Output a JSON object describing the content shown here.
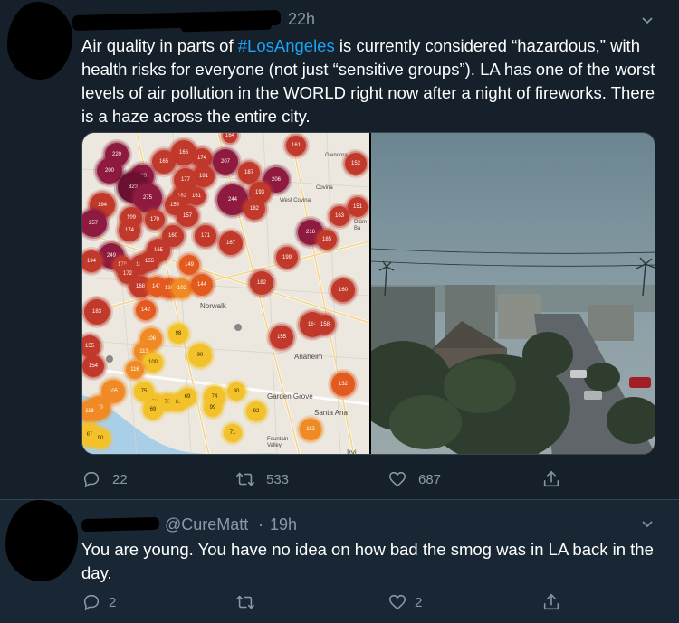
{
  "tweet1": {
    "timestamp": "22h",
    "text_before": "Air quality in parts of ",
    "hashtag": "#LosAngeles",
    "text_after": " is currently considered “hazardous,” with health risks for everyone (not just “sensitive groups”). LA has one of the worst levels of air pollution in the WORLD right now after a night of fireworks. There is a haze across the entire city.",
    "map_labels": {
      "glendora": "Glendora",
      "covina": "Covina",
      "west_covina": "West Covina",
      "norwalk": "Norwalk",
      "anaheim": "Anaheim",
      "garden_grove": "Garden Grove",
      "santa_ana": "Santa Ana",
      "fountain_valley": "Fountain Valley",
      "diamond_bar": "Diam Ba",
      "irvine": "Irvi"
    },
    "aqi_markers": [
      {
        "v": "164",
        "c": "#c0392b"
      },
      {
        "v": "161",
        "c": "#c0392b"
      },
      {
        "v": "220",
        "c": "#8e1b3f"
      },
      {
        "v": "166",
        "c": "#c0392b"
      },
      {
        "v": "174",
        "c": "#c0392b"
      },
      {
        "v": "207",
        "c": "#8e1b3f"
      },
      {
        "v": "187",
        "c": "#c0392b"
      },
      {
        "v": "152",
        "c": "#c0392b"
      },
      {
        "v": "165",
        "c": "#c0392b"
      },
      {
        "v": "200",
        "c": "#8e1b3f"
      },
      {
        "v": "181",
        "c": "#c0392b"
      },
      {
        "v": "233",
        "c": "#8e1b3f"
      },
      {
        "v": "177",
        "c": "#c0392b"
      },
      {
        "v": "206",
        "c": "#8e1b3f"
      },
      {
        "v": "323",
        "c": "#6b1030"
      },
      {
        "v": "275",
        "c": "#8e1b3f"
      },
      {
        "v": "162",
        "c": "#c0392b"
      },
      {
        "v": "161",
        "c": "#c0392b"
      },
      {
        "v": "193",
        "c": "#c0392b"
      },
      {
        "v": "244",
        "c": "#8e1b3f"
      },
      {
        "v": "194",
        "c": "#c0392b"
      },
      {
        "v": "156",
        "c": "#c0392b"
      },
      {
        "v": "182",
        "c": "#c0392b"
      },
      {
        "v": "151",
        "c": "#c0392b"
      },
      {
        "v": "199",
        "c": "#c0392b"
      },
      {
        "v": "170",
        "c": "#c0392b"
      },
      {
        "v": "157",
        "c": "#c0392b"
      },
      {
        "v": "163",
        "c": "#c0392b"
      },
      {
        "v": "257",
        "c": "#8e1b3f"
      },
      {
        "v": "174",
        "c": "#c0392b"
      },
      {
        "v": "160",
        "c": "#c0392b"
      },
      {
        "v": "171",
        "c": "#c0392b"
      },
      {
        "v": "216",
        "c": "#8e1b3f"
      },
      {
        "v": "185",
        "c": "#c0392b"
      },
      {
        "v": "167",
        "c": "#c0392b"
      },
      {
        "v": "165",
        "c": "#c0392b"
      },
      {
        "v": "249",
        "c": "#8e1b3f"
      },
      {
        "v": "194",
        "c": "#c0392b"
      },
      {
        "v": "178",
        "c": "#c0392b"
      },
      {
        "v": "168",
        "c": "#c0392b"
      },
      {
        "v": "155",
        "c": "#c0392b"
      },
      {
        "v": "149",
        "c": "#e35a1f"
      },
      {
        "v": "199",
        "c": "#c0392b"
      },
      {
        "v": "172",
        "c": "#c0392b"
      },
      {
        "v": "168",
        "c": "#c0392b"
      },
      {
        "v": "143",
        "c": "#e35a1f"
      },
      {
        "v": "139",
        "c": "#e35a1f"
      },
      {
        "v": "102",
        "c": "#f08a24"
      },
      {
        "v": "144",
        "c": "#e35a1f"
      },
      {
        "v": "182",
        "c": "#c0392b"
      },
      {
        "v": "160",
        "c": "#c0392b"
      },
      {
        "v": "183",
        "c": "#c0392b"
      },
      {
        "v": "142",
        "c": "#e35a1f"
      },
      {
        "v": "164",
        "c": "#c0392b"
      },
      {
        "v": "158",
        "c": "#c0392b"
      },
      {
        "v": "106",
        "c": "#f08a24"
      },
      {
        "v": "98",
        "c": "#f3c22b"
      },
      {
        "v": "155",
        "c": "#c0392b"
      },
      {
        "v": "155",
        "c": "#c0392b"
      },
      {
        "v": "113",
        "c": "#f08a24"
      },
      {
        "v": "90",
        "c": "#f3c22b"
      },
      {
        "v": "100",
        "c": "#f3c22b"
      },
      {
        "v": "116",
        "c": "#f08a24"
      },
      {
        "v": "154",
        "c": "#c0392b"
      },
      {
        "v": "132",
        "c": "#e35a1f"
      },
      {
        "v": "105",
        "c": "#f08a24"
      },
      {
        "v": "75",
        "c": "#f3c22b"
      },
      {
        "v": "73",
        "c": "#f3c22b"
      },
      {
        "v": "75",
        "c": "#f3c22b"
      },
      {
        "v": "65",
        "c": "#f3c22b"
      },
      {
        "v": "69",
        "c": "#f3c22b"
      },
      {
        "v": "74",
        "c": "#f3c22b"
      },
      {
        "v": "80",
        "c": "#f3c22b"
      },
      {
        "v": "99",
        "c": "#f3c22b"
      },
      {
        "v": "109",
        "c": "#f08a24"
      },
      {
        "v": "92",
        "c": "#f3c22b"
      },
      {
        "v": "69",
        "c": "#f3c22b"
      },
      {
        "v": "118",
        "c": "#f08a24"
      },
      {
        "v": "112",
        "c": "#f08a24"
      },
      {
        "v": "71",
        "c": "#f3c22b"
      },
      {
        "v": "67",
        "c": "#f3c22b"
      },
      {
        "v": "90",
        "c": "#f3c22b"
      }
    ],
    "actions": {
      "reply_count": "22",
      "retweet_count": "533",
      "like_count": "687"
    }
  },
  "tweet2": {
    "handle": "@CureMatt",
    "separator": "·",
    "timestamp": "19h",
    "text": "You are young. You have no idea on how bad the smog was in LA back in the day.",
    "actions": {
      "reply_count": "2",
      "retweet_count": "",
      "like_count": "2"
    }
  },
  "colors": {
    "background": "#15202b",
    "reply_background": "#192734",
    "accent": "#1da1f2",
    "muted": "#8899a6",
    "border": "#38444d"
  },
  "icons": {
    "reply": "reply-icon",
    "retweet": "retweet-icon",
    "like": "heart-icon",
    "share": "share-icon",
    "menu": "chevron-down-icon"
  }
}
